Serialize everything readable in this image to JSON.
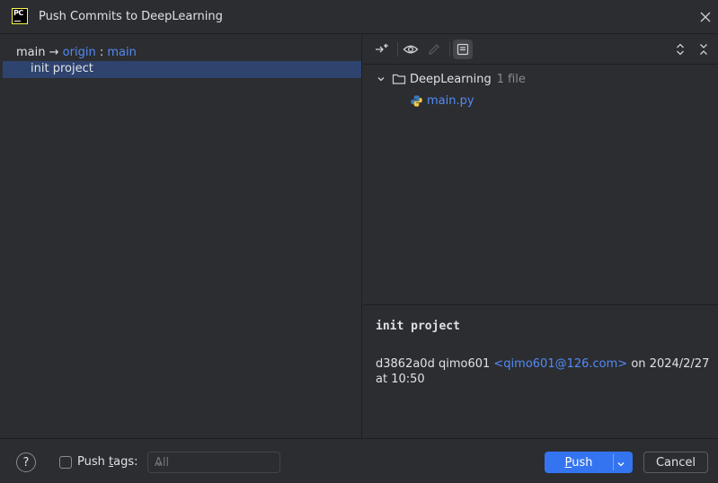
{
  "window": {
    "title": "Push Commits to DeepLearning",
    "logo_text": "PC"
  },
  "branch": {
    "local": "main",
    "arrow": "→",
    "remote": "origin",
    "separator": ":",
    "remote_branch": "main"
  },
  "commits": [
    {
      "message": "init project"
    }
  ],
  "tree": {
    "folder_name": "DeepLearning",
    "folder_count": "1 file",
    "file_name": "main.py"
  },
  "details": {
    "message": "init project",
    "hash": "d3862a0d",
    "author": "qimo601",
    "email": "<qimo601@126.com>",
    "on_text": "on",
    "date": "2024/2/27",
    "at_text": "at",
    "time": "10:50"
  },
  "footer": {
    "help_label": "?",
    "push_tags_prefix": "Push ",
    "push_tags_mnemonic": "t",
    "push_tags_suffix": "ags:",
    "tags_select_value": "All",
    "push_mnemonic": "P",
    "push_rest": "ush",
    "cancel_label": "Cancel"
  },
  "colors": {
    "accent": "#3574f0",
    "link": "#548af7",
    "selection": "#2e436e",
    "background": "#2b2d30"
  }
}
